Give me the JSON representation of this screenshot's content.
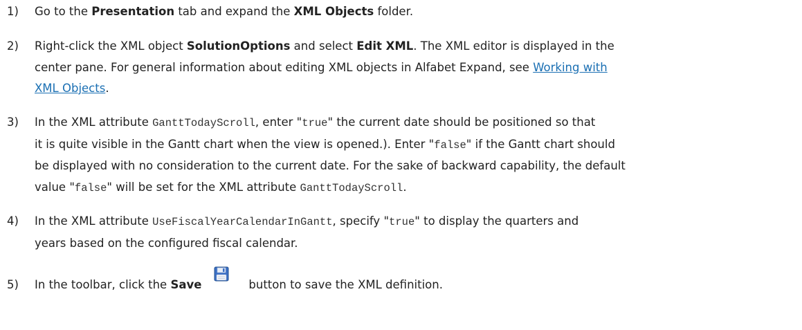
{
  "steps": [
    {
      "number": "1)",
      "t1": "Go to the ",
      "b1": "Presentation",
      "t2": " tab and expand the ",
      "b2": "XML Objects",
      "t3": " folder."
    },
    {
      "number": "2)",
      "t1": "Right-click the XML object ",
      "b1": "SolutionOptions",
      "t2": " and select ",
      "b2": "Edit XML",
      "t3": ". The XML editor is displayed in the",
      "t4": "center pane. For general information about editing XML objects in Alfabet Expand, see ",
      "link_part1": "Working with ",
      "link_part2": "XML Objects",
      "t5": "."
    },
    {
      "number": "3)",
      "t1": "In the XML attribute ",
      "c1": "GanttTodayScroll",
      "t2": ", enter \"",
      "c2": "true",
      "t3": "\" the current date should be positioned so that",
      "t4": "it is quite visible in the Gantt chart when the view is opened.). Enter \"",
      "c3": "false",
      "t5": "\" if the Gantt chart should",
      "t6": "be displayed with no consideration to the current date. For the sake of backward capability, the default",
      "t7": "value \"",
      "c4": "false",
      "t8": "\" will be set for the XML attribute ",
      "c5": "GanttTodayScroll",
      "t9": "."
    },
    {
      "number": "4)",
      "t1": "In the XML attribute ",
      "c1": "UseFiscalYearCalendarInGantt",
      "t2": ", specify \"",
      "c2": "true",
      "t3": "\" to display the quarters and",
      "t4": "years based on the configured fiscal calendar."
    },
    {
      "number": "5)",
      "t1": "In the toolbar, click the ",
      "b1": "Save",
      "icon": "save-floppy-icon",
      "t2": "button to save the XML definition."
    }
  ],
  "colors": {
    "text": "#222222",
    "link": "#1a6fb3",
    "icon_blue": "#3b6fc4"
  }
}
